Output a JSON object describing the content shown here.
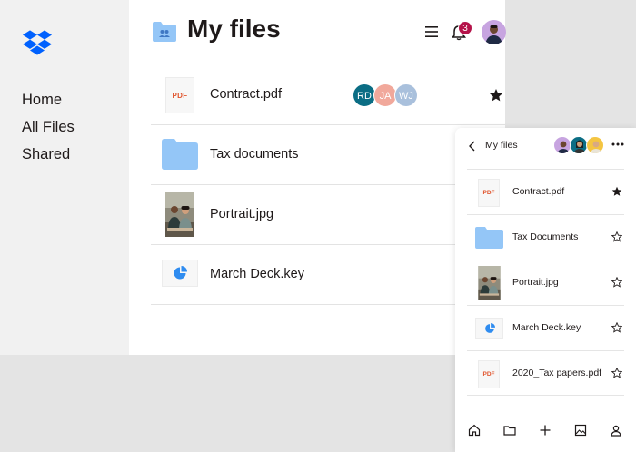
{
  "sidebar": {
    "logo_icon": "dropbox-logo-icon",
    "items": [
      {
        "label": "Home"
      },
      {
        "label": "All Files"
      },
      {
        "label": "Shared"
      }
    ]
  },
  "header": {
    "title": "My files",
    "notification_count": "3",
    "icons": [
      "folder-shared-icon",
      "menu-icon",
      "bell-icon",
      "avatar"
    ]
  },
  "files": [
    {
      "name": "Contract.pdf",
      "type": "pdf",
      "thumb_label": "PDF",
      "starred": true,
      "shared_with": [
        "RD",
        "JA",
        "WJ"
      ]
    },
    {
      "name": "Tax documents",
      "type": "folder",
      "starred": false
    },
    {
      "name": "Portrait.jpg",
      "type": "image",
      "starred": false
    },
    {
      "name": "March Deck.key",
      "type": "keynote",
      "starred": false
    }
  ],
  "colors": {
    "accent_blue": "#0061fe",
    "folder_blue": "#94c6f7",
    "badge_red": "#b5134a",
    "avatar_rd": "#0b6d84",
    "avatar_ja": "#f1a89b",
    "avatar_wj": "#a9c0dc"
  },
  "phone": {
    "title": "My files",
    "files": [
      {
        "name": "Contract.pdf",
        "type": "pdf",
        "thumb_label": "PDF",
        "starred": true
      },
      {
        "name": "Tax Documents",
        "type": "folder",
        "starred": false
      },
      {
        "name": "Portrait.jpg",
        "type": "image",
        "starred": false
      },
      {
        "name": "March Deck.key",
        "type": "keynote",
        "starred": false
      },
      {
        "name": "2020_Tax papers.pdf",
        "type": "pdf",
        "thumb_label": "PDF",
        "starred": false
      }
    ],
    "tabs": [
      "home-icon",
      "folder-icon",
      "plus-icon",
      "photos-icon",
      "account-icon"
    ]
  }
}
